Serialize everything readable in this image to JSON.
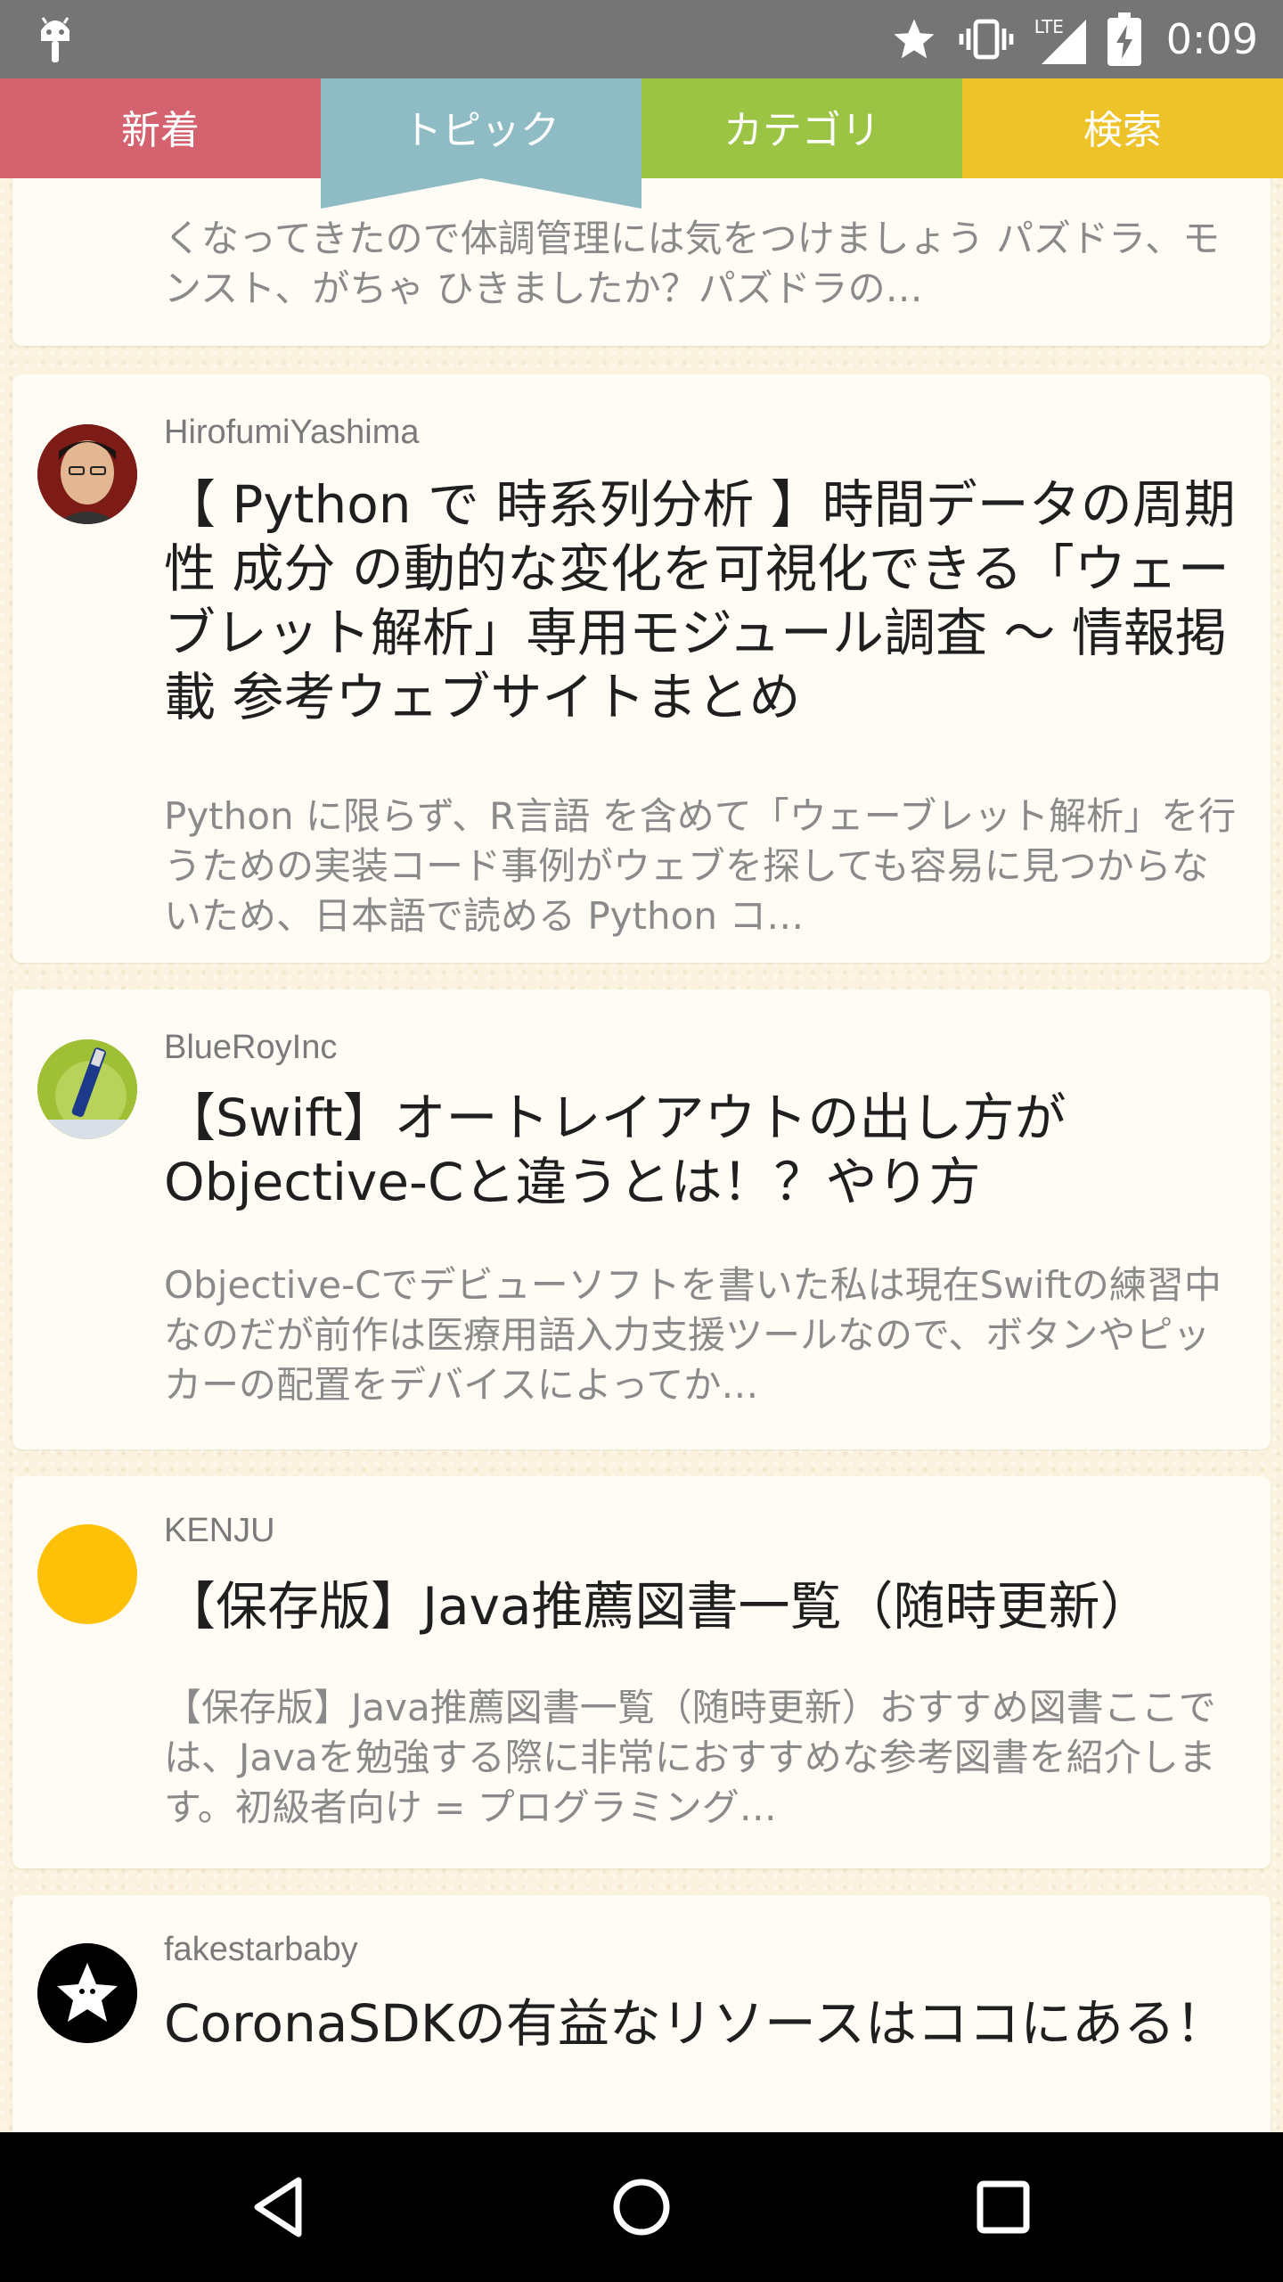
{
  "status_bar": {
    "time": "0:09",
    "network": "LTE",
    "icons": [
      "android-icon",
      "star-icon",
      "vibrate-icon",
      "signal-icon",
      "battery-charging-icon"
    ]
  },
  "tabs": [
    {
      "label": "新着",
      "color": "#d4636f"
    },
    {
      "label": "トピック",
      "color": "#8fbcc4",
      "active": true
    },
    {
      "label": "カテゴリ",
      "color": "#9bc444"
    },
    {
      "label": "検索",
      "color": "#eec32a"
    }
  ],
  "feed": {
    "partial_card": {
      "excerpt": "くなってきたので体調管理には気をつけましょう パズドラ、モンスト、がちゃ ひきましたか？パズドラの…"
    },
    "cards": [
      {
        "user": "HirofumiYashima",
        "avatar": "person-photo",
        "title": "【 Python で 時系列分析 】時間データの周期性 成分 の動的な変化を可視化できる「ウェーブレット解析」専用モジュール調査 ～ 情報掲載 参考ウェブサイトまとめ",
        "excerpt": "Python に限らず、R言語 を含めて「ウェーブレット解析」を行うための実装コード事例がウェブを探しても容易に見つからないため、日本語で読める Python コ…"
      },
      {
        "user": "BlueRoyInc",
        "avatar": "pen-photo",
        "title": "【Swift】オートレイアウトの出し方がObjective-Cと違うとは！？やり方",
        "excerpt": "Objective-Cでデビューソフトを書いた私は現在Swiftの練習中なのだが前作は医療用語入力支援ツールなので、ボタンやピッカーの配置をデバイスによってか…"
      },
      {
        "user": "KENJU",
        "avatar": "yellow-circle",
        "title": "【保存版】Java推薦図書一覧（随時更新）",
        "excerpt": "【保存版】Java推薦図書一覧（随時更新）おすすめ図書ここでは、Javaを勉強する際に非常におすすめな参考図書を紹介します。初級者向け = プログラミング…"
      },
      {
        "user": "fakestarbaby",
        "avatar": "star-logo",
        "title": "CoronaSDKの有益なリソースはココにある！",
        "excerpt": ""
      }
    ]
  },
  "nav_bar": {
    "buttons": [
      "back-icon",
      "home-icon",
      "recents-icon"
    ]
  }
}
